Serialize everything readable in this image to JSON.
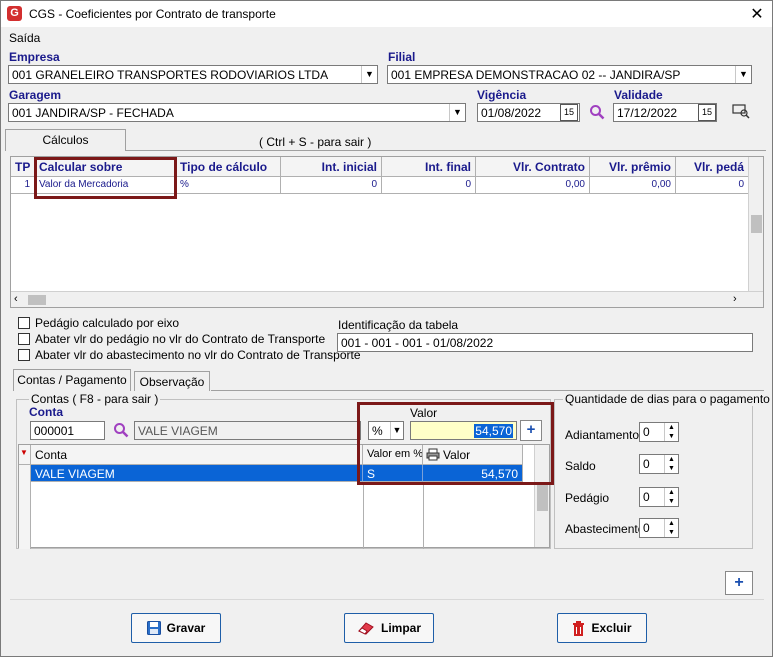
{
  "window": {
    "title": "CGS - Coeficientes por Contrato de transporte",
    "close": "✕"
  },
  "menu": {
    "saida": "Saída"
  },
  "empresa": {
    "label": "Empresa",
    "value": "001 GRANELEIRO TRANSPORTES RODOVIARIOS LTDA"
  },
  "filial": {
    "label": "Filial",
    "value": "001 EMPRESA DEMONSTRACAO 02 -- JANDIRA/SP"
  },
  "garagem": {
    "label": "Garagem",
    "value": "001 JANDIRA/SP - FECHADA"
  },
  "vigencia": {
    "label": "Vigência",
    "value": "01/08/2022"
  },
  "validade": {
    "label": "Validade",
    "value": "17/12/2022"
  },
  "tabs_top": {
    "calculos": "Cálculos",
    "hint": "( Ctrl + S - para sair )"
  },
  "calc_grid": {
    "headers": [
      "TP",
      "Calcular sobre",
      "Tipo de cálculo",
      "Int. inicial",
      "Int. final",
      "Vlr. Contrato",
      "Vlr. prêmio",
      "Vlr. pedá"
    ],
    "row": [
      "1",
      "Valor da Mercadoria",
      "%",
      "0",
      "0",
      "0,00",
      "0,00",
      "0"
    ]
  },
  "checks": {
    "pedagio_eixo": "Pedágio calculado por eixo",
    "abater_pedagio": "Abater vlr do pedágio no vlr do Contrato de Transporte",
    "abater_abastecimento": "Abater vlr do abastecimento no vlr do Contrato de Transporte"
  },
  "identificacao": {
    "label": "Identificação da tabela",
    "value": "001 - 001 - 001 - 01/08/2022"
  },
  "tabs_bottom": {
    "contas": "Contas / Pagamento",
    "observacao": "Observação"
  },
  "contas": {
    "group_label": "Contas ( F8 - para sair )",
    "conta_label": "Conta",
    "conta_code": "000001",
    "conta_name": "VALE VIAGEM",
    "valor_label": "Valor",
    "tipo": "%",
    "valor": "54,570",
    "add": "+",
    "grid_headers": [
      "Conta",
      "Valor em %",
      "Valor"
    ],
    "grid_row": [
      "VALE VIAGEM",
      "S",
      "54,570"
    ]
  },
  "dias": {
    "group_label": "Quantidade de dias para o pagamento",
    "adiantamento": "Adiantamento",
    "adiantamento_val": "0",
    "saldo": "Saldo",
    "saldo_val": "0",
    "pedagio": "Pedágio",
    "pedagio_val": "0",
    "abastecimento": "Abastecimento",
    "abastecimento_val": "0"
  },
  "add_button": "+",
  "buttons": {
    "gravar": "Gravar",
    "limpar": "Limpar",
    "excluir": "Excluir"
  }
}
